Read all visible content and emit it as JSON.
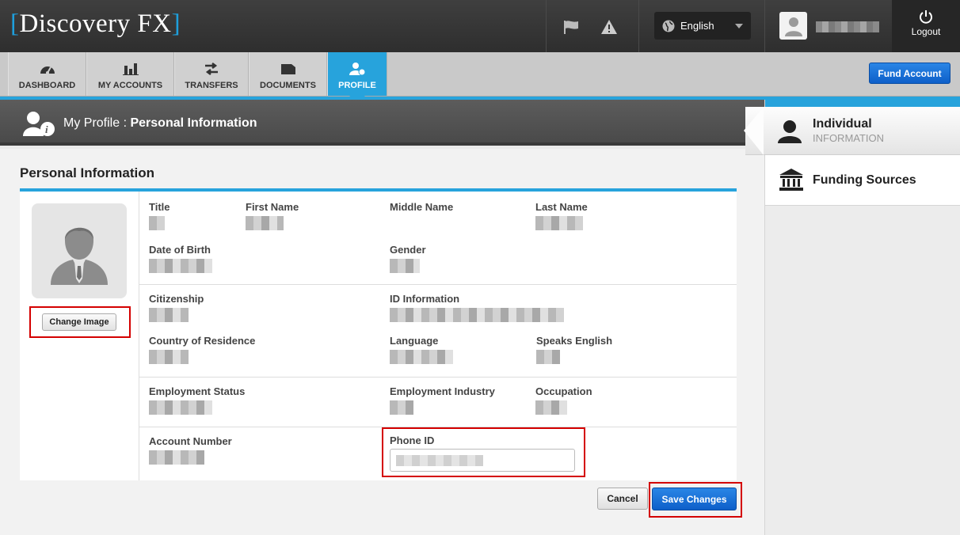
{
  "brand": {
    "name": "Discovery FX",
    "bracket_left": "[",
    "bracket_right": "]"
  },
  "topbar": {
    "language": "English",
    "logout_label": "Logout"
  },
  "nav": {
    "tabs": [
      {
        "label": "DASHBOARD",
        "icon": "gauge-icon"
      },
      {
        "label": "MY ACCOUNTS",
        "icon": "bar-chart-icon"
      },
      {
        "label": "TRANSFERS",
        "icon": "transfer-arrows-icon"
      },
      {
        "label": "DOCUMENTS",
        "icon": "folder-icon"
      },
      {
        "label": "PROFILE",
        "icon": "profile-icon",
        "active": true
      }
    ],
    "fund_account_label": "Fund Account"
  },
  "header": {
    "prefix": "My Profile : ",
    "title": "Personal Information"
  },
  "section": {
    "title": "Personal Information",
    "change_image_label": "Change Image",
    "fields": {
      "title": "Title",
      "first_name": "First Name",
      "middle_name": "Middle Name",
      "last_name": "Last Name",
      "dob": "Date of Birth",
      "gender": "Gender",
      "citizenship": "Citizenship",
      "id_information": "ID Information",
      "country_of_residence": "Country of Residence",
      "language": "Language",
      "speaks_english": "Speaks English",
      "employment_status": "Employment Status",
      "employment_industry": "Employment Industry",
      "occupation": "Occupation",
      "account_number": "Account Number",
      "phone_id": "Phone ID"
    },
    "cancel_label": "Cancel",
    "save_label": "Save Changes"
  },
  "sidebar": {
    "items": [
      {
        "title": "Individual",
        "subtitle": "INFORMATION",
        "icon": "person-icon",
        "active": true
      },
      {
        "title": "Funding Sources",
        "icon": "bank-icon"
      }
    ]
  },
  "colors": {
    "accent": "#27a3dc",
    "primary_button": "#0d5fc9",
    "highlight": "#d40000"
  }
}
